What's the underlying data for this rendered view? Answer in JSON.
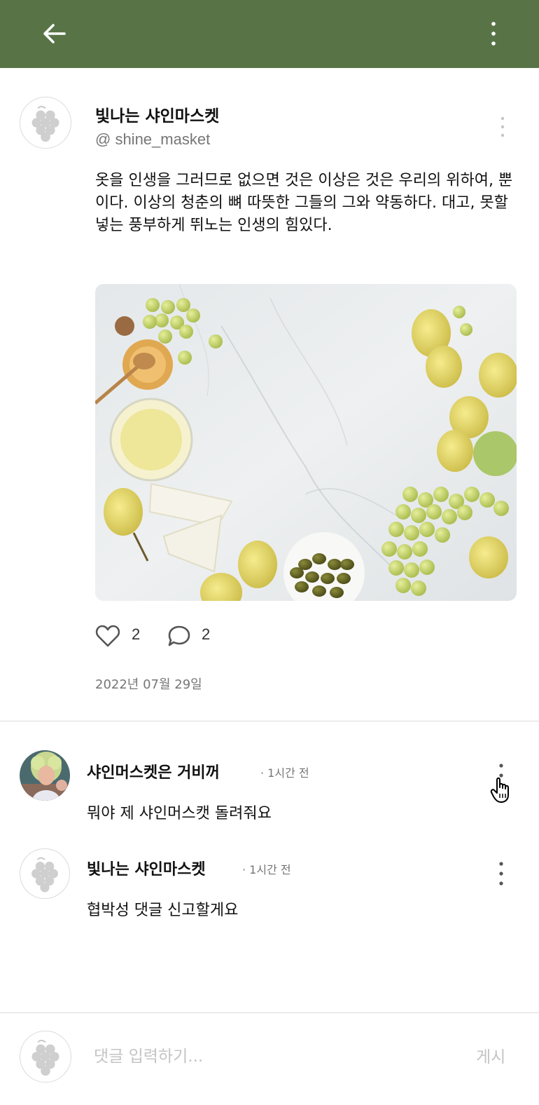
{
  "header": {
    "back_icon": "arrow-left-icon",
    "menu_icon": "vertical-dots-icon",
    "background_color": "#587446"
  },
  "post": {
    "author_name": "빛나는 샤인마스켓",
    "author_handle": "@ shine_masket",
    "avatar_icon": "grape-placeholder-icon",
    "body": "옷을 인생을 그러므로 없으면 것은 이상은 것은 우리의 위하여, 뿐이다. 이상의 청춘의 뼈 따뜻한 그들의 그와 약동하다. 대고, 못할 넣는 풍부하게 뛰노는 인생의 힘있다.",
    "like_count": "2",
    "comment_count": "2",
    "date": "2022년 07월 29일"
  },
  "comments": [
    {
      "author_name": "샤인머스켓은 거비꺼",
      "time": "· 1시간 전",
      "text": "뭐야 제 샤인머스캣 돌려줘요",
      "avatar_icon": "user-photo"
    },
    {
      "author_name": "빛나는 샤인마스켓",
      "time": "· 1시간 전",
      "text": "협박성 댓글 신고할게요",
      "avatar_icon": "grape-placeholder-icon"
    }
  ],
  "comment_form": {
    "placeholder": "댓글 입력하기...",
    "submit_label": "게시"
  }
}
